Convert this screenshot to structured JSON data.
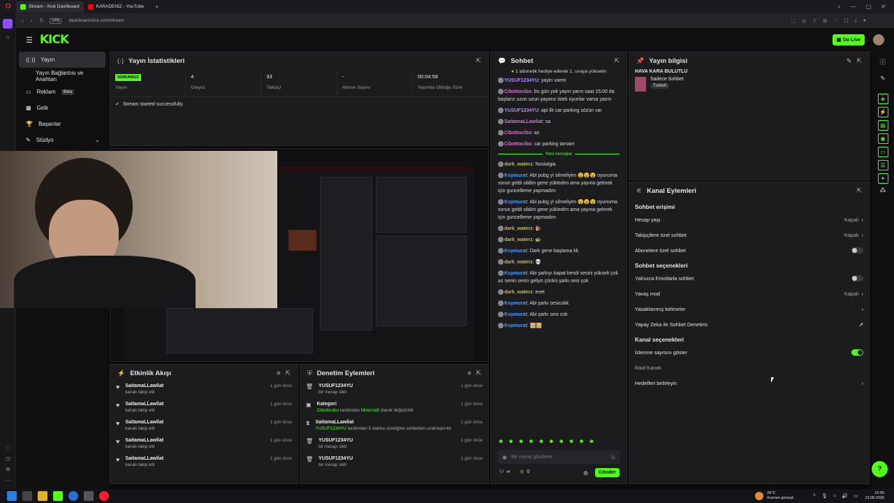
{
  "browser": {
    "tabs": [
      {
        "label": "Stream - Kick Dashboard",
        "active": true
      },
      {
        "label": "KARADENİZ - YouTube",
        "active": false
      }
    ],
    "url": "dashboard.kick.com/stream",
    "vpn": "VPN"
  },
  "topnav": {
    "logo": "KICK",
    "go_live": "Go Live"
  },
  "sidebar": {
    "items": [
      {
        "label": "Yayın",
        "icon": "broadcast-icon"
      },
      {
        "label": "Yayın Bağlantısı ve Anahtarı",
        "icon": ""
      },
      {
        "label": "Reklam",
        "badge": "Beta",
        "icon": "ad-icon"
      },
      {
        "label": "Gelir",
        "icon": "revenue-icon"
      },
      {
        "label": "Başarılar",
        "icon": "trophy-icon"
      },
      {
        "label": "Stüdyo",
        "icon": "studio-icon"
      }
    ]
  },
  "stats": {
    "title": "Yayın İstatistikleri",
    "status_badge": "SORUNSUZ",
    "cols": [
      {
        "value": "",
        "label": "Yayın"
      },
      {
        "value": "4",
        "label": "İzleyici"
      },
      {
        "value": "33",
        "label": "Takipçi"
      },
      {
        "value": "-",
        "label": "Abone Sayısı"
      },
      {
        "value": "00:04:58",
        "label": "Yayında Olduğu Süre"
      }
    ],
    "success": "Stream started successfully."
  },
  "chat": {
    "title": "Sohbet",
    "pinned": "1 abonelik hediye ederek 1. sıraya yükselin",
    "divider": "Yeni mesajlar",
    "messages_before": [
      {
        "user": "YUSUF1234YU",
        "color": "#b38bff",
        "text": "yayin varmi"
      },
      {
        "user": "Cibottocibo",
        "color": "#e06bd8",
        "text": "bu gün yok yayın yarın saat 15:00 da başlarız uzun uzun yayarız istek oyunlar varsa yazın"
      },
      {
        "user": "YUSUF1234YU",
        "color": "#b38bff",
        "text": "api ilk car parking sözün var"
      },
      {
        "user": "SaitamaLLawliat",
        "color": "#e06bd8",
        "text": "sa"
      },
      {
        "user": "Cibottocibo",
        "color": "#e06bd8",
        "text": "as"
      },
      {
        "user": "Cibottocibo",
        "color": "#e06bd8",
        "text": "car parking tamam"
      }
    ],
    "messages_after": [
      {
        "user": "dark_waterz",
        "color": "#c9b949",
        "text": "Nostalgia"
      },
      {
        "user": "Kvpmurat",
        "color": "#4a9eff",
        "text": "Abi pubg yi silmeliyim 😵😵😵 oyunuma sorun geldi sildim gene yükledim ama yayına gelmek için guncelleme yapmadım"
      },
      {
        "user": "Kvpmurat",
        "color": "#4a9eff",
        "text": "Abi pubg yi silmeliyim 😵😵😵 oyunuma sorun geldi sildim gene yükledim ama yayına gelmek için guncelleme yapmadım"
      },
      {
        "user": "dark_waterz",
        "color": "#c9b949",
        "text": "🐌"
      },
      {
        "user": "dark_waterz",
        "color": "#c9b949",
        "text": "🐢"
      },
      {
        "user": "Kvpmurat",
        "color": "#4a9eff",
        "text": "Dark gene başlama kk"
      },
      {
        "user": "dark_waterz",
        "color": "#c9b949",
        "text": "💀"
      },
      {
        "user": "Kvpmurat",
        "color": "#4a9eff",
        "text": "Abi şarkıyı kapat kendi sesini yükselt çok az senin sesin geliyo çünkü şarkı sesi çok"
      },
      {
        "user": "dark_waterz",
        "color": "#c9b949",
        "text": "evet"
      },
      {
        "user": "Kvpmurat",
        "color": "#4a9eff",
        "text": "Abi şarkı sesicokk"
      },
      {
        "user": "Kvpmurat",
        "color": "#4a9eff",
        "text": "Abi şarkı sesi cok"
      },
      {
        "user": "Kvpmurat",
        "color": "#4a9eff",
        "text": "🖼️🖼️"
      }
    ],
    "input_placeholder": "Bir mesaj gönderin",
    "count1": "∞",
    "count2": "0",
    "send": "Gönder"
  },
  "stream_info": {
    "title": "Yayın bilgisi",
    "stream_title": "HAVA KARA BULUTLU",
    "category": "Sadece Sohbet",
    "tag": "Turkish"
  },
  "channel_actions": {
    "title": "Kanal Eylemleri",
    "section1": "Sohbet erişimi",
    "account_age": "Hesap yaşı",
    "account_age_val": "Kapalı",
    "followers_only": "Takipçilere özel sohbet",
    "followers_only_val": "Kapalı",
    "subs_only": "Abonelere özel sohbet",
    "section2": "Sohbet seçenekleri",
    "emotes_only": "Yalnızca Emotlarla sohbet",
    "slow_mode": "Yavaş mod",
    "slow_mode_val": "Kapalı",
    "banned_words": "Yasaklanmış kelimeler",
    "ai_mod": "Yapay Zeka ile Sohbet Denetimi",
    "section3": "Kanal seçenekleri",
    "show_viewers": "İzlenme sayısını göster",
    "raid": "Raid Kanalı",
    "goals": "Hedefleri belirleyin"
  },
  "activity": {
    "title": "Etkinlik Akışı",
    "items": [
      {
        "name": "SaitamaLLawliat",
        "sub": "kanalı takip etti",
        "time": "1 gün önce"
      },
      {
        "name": "SaitamaLLawliat",
        "sub": "kanalı takip etti",
        "time": "1 gün önce"
      },
      {
        "name": "SaitamaLLawliat",
        "sub": "kanalı takip etti",
        "time": "1 gün önce"
      },
      {
        "name": "SaitamaLLawliat",
        "sub": "kanalı takip etti",
        "time": "1 gün önce"
      },
      {
        "name": "SaitamaLLawliat",
        "sub": "kanalı takip etti",
        "time": "1 gün önce"
      }
    ]
  },
  "moderation": {
    "title": "Denetim Eylemleri",
    "items": [
      {
        "name": "YUSUF1234YU",
        "sub": "bir mesajı sildi",
        "time": "1 gün önce",
        "icon": "trash-icon"
      },
      {
        "name": "Kategori",
        "sub_user": "Cibottocibo",
        "sub_mid": " tarafından ",
        "sub_user2": "Minecraft",
        "sub_end": " olarak değiştirildi",
        "time": "1 gün önce",
        "icon": "category-icon"
      },
      {
        "name": "SaitamaLLawliat",
        "sub_user": "YUSUF1234YU",
        "sub_mid": " tarafından 5 dakika süreliğine sohbetten uzaklaştırıldı",
        "sub_user2": "",
        "sub_end": "",
        "time": "1 gün önce",
        "icon": "hourglass-icon"
      },
      {
        "name": "YUSUF1234YU",
        "sub": "bir mesajı sildi",
        "time": "1 gün önce",
        "icon": "trash-icon"
      },
      {
        "name": "YUSUF1234YU",
        "sub": "bir mesajı sildi",
        "time": "1 gün önce",
        "icon": "trash-icon"
      }
    ]
  },
  "taskbar": {
    "weather_temp": "26°C",
    "weather_desc": "Kısmen güneşli",
    "time": "15:05",
    "date": "13.08.2026"
  },
  "colors": {
    "accent": "#53fc18",
    "panel": "#1c1c1f",
    "bg": "#0b0b0c"
  }
}
